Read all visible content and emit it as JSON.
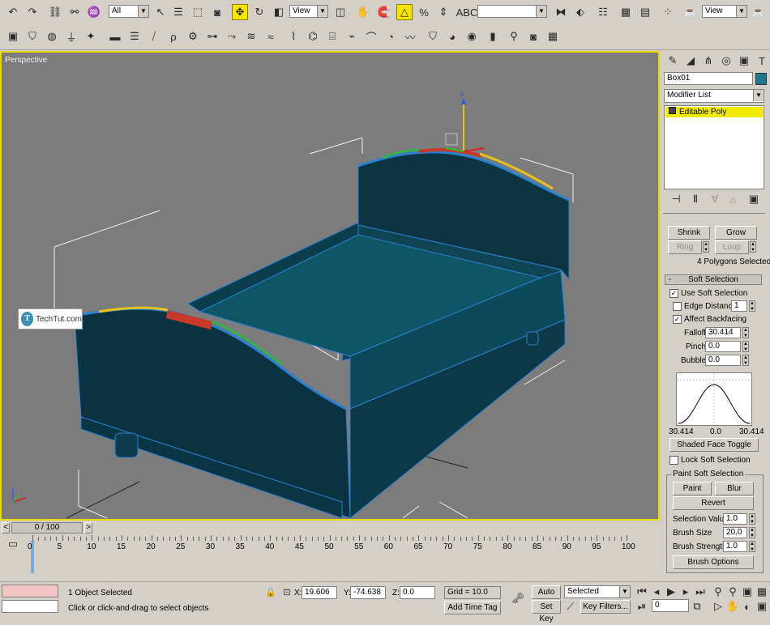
{
  "toolbar_main": {
    "filter_value": "All",
    "ref_coord_value": "View",
    "named_selection_value": "",
    "render_view_value": "View"
  },
  "viewport": {
    "label": "Perspective",
    "watermark": "TechTut.com",
    "watermark_logo": "T",
    "axis_z": "z",
    "colors": {
      "border": "#e5d900",
      "bg": "#7c7c7c",
      "model": "#0d3a48",
      "wire": "#2a7fcf"
    }
  },
  "command_panel": {
    "object_name": "Box01",
    "object_color": "#1a7a8c",
    "modifier_list": "Modifier List",
    "stack_item": "Editable Poly",
    "selection": {
      "shrink": "Shrink",
      "grow": "Grow",
      "ring": "Ring",
      "loop": "Loop",
      "status": "4 Polygons Selected"
    },
    "soft_selection": {
      "title": "Soft Selection",
      "collapse": "-",
      "use_soft": "Use Soft Selection",
      "edge_distance": "Edge Distance:",
      "edge_distance_value": "1",
      "affect_backfacing": "Affect Backfacing",
      "falloff_label": "Falloff:",
      "falloff_value": "30.414",
      "pinch_label": "Pinch:",
      "pinch_value": "0.0",
      "bubble_label": "Bubble:",
      "bubble_value": "0.0",
      "curve_left": "30.414",
      "curve_mid": "0.0",
      "curve_right": "30.414",
      "shaded_face_toggle": "Shaded Face Toggle",
      "lock_soft": "Lock Soft Selection",
      "paint_group": "Paint Soft Selection",
      "paint": "Paint",
      "blur": "Blur",
      "revert": "Revert",
      "sel_value_label": "Selection Value",
      "sel_value": "1.0",
      "brush_size_label": "Brush Size",
      "brush_size": "20.0",
      "brush_strength_label": "Brush Strength",
      "brush_strength": "1.0",
      "brush_options": "Brush Options"
    }
  },
  "timeline": {
    "frame": "0 / 100",
    "prev": "<",
    "next": ">",
    "ticks": [
      "0",
      "5",
      "10",
      "15",
      "20",
      "25",
      "30",
      "35",
      "40",
      "45",
      "50",
      "55",
      "60",
      "65",
      "70",
      "75",
      "80",
      "85",
      "90",
      "95",
      "100"
    ]
  },
  "status_bar": {
    "selected": "1 Object Selected",
    "prompt": "Click or click-and-drag to select objects",
    "x_label": "X:",
    "x_value": "19.606",
    "y_label": "Y:",
    "y_value": "-74.638",
    "z_label": "Z:",
    "z_value": "0.0",
    "grid": "Grid = 10.0",
    "add_time_tag": "Add Time Tag",
    "auto_key": "Auto Key",
    "set_key": "Set Key",
    "key_mode": "Selected",
    "key_filters": "Key Filters...",
    "current_frame": "0"
  }
}
